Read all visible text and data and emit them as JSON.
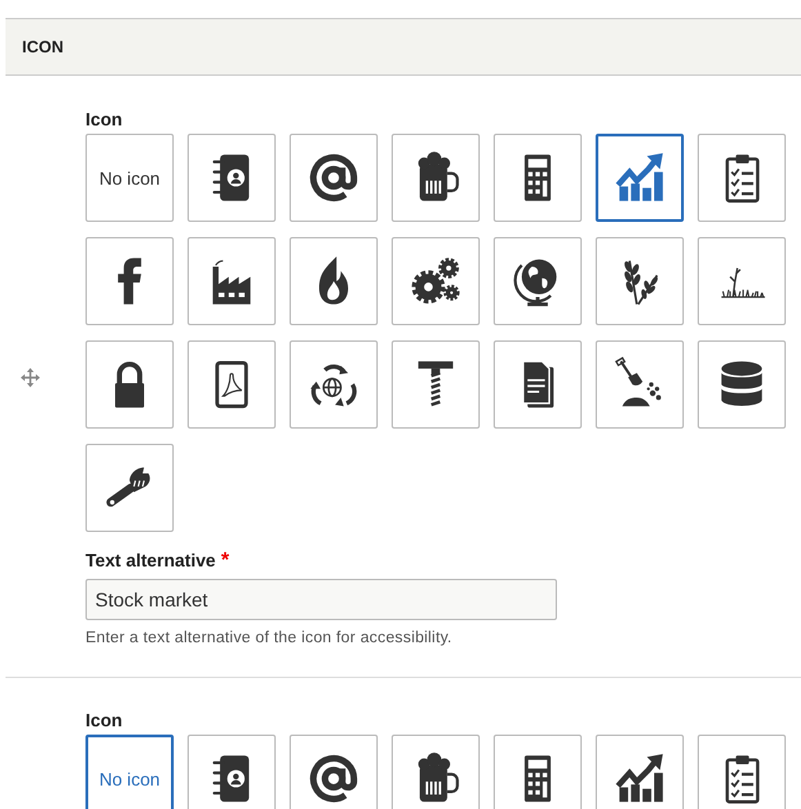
{
  "section": {
    "title": "ICON"
  },
  "widgets": [
    {
      "draggable": true,
      "label": "Icon",
      "tiles": [
        {
          "kind": "none",
          "label": "No icon",
          "selected": false
        },
        {
          "kind": "icon",
          "selected": false
        },
        {
          "kind": "icon",
          "selected": false
        },
        {
          "kind": "icon",
          "selected": false
        },
        {
          "kind": "icon",
          "selected": false
        },
        {
          "kind": "icon",
          "selected": true
        },
        {
          "kind": "icon",
          "selected": false
        },
        {
          "kind": "icon",
          "selected": false
        },
        {
          "kind": "icon",
          "selected": false
        },
        {
          "kind": "icon",
          "selected": false
        },
        {
          "kind": "icon",
          "selected": false
        },
        {
          "kind": "icon",
          "selected": false
        },
        {
          "kind": "icon",
          "selected": false
        },
        {
          "kind": "icon",
          "selected": false
        },
        {
          "kind": "icon",
          "selected": false
        },
        {
          "kind": "icon",
          "selected": false
        },
        {
          "kind": "icon",
          "selected": false
        },
        {
          "kind": "icon",
          "selected": false
        },
        {
          "kind": "icon",
          "selected": false
        },
        {
          "kind": "icon",
          "selected": false
        },
        {
          "kind": "icon",
          "selected": false
        },
        {
          "kind": "icon",
          "selected": false
        }
      ],
      "text_alternative": {
        "label": "Text alternative",
        "required_mark": "*",
        "value": "Stock market",
        "help": "Enter a text alternative of the icon for accessibility."
      }
    },
    {
      "label": "Icon",
      "tiles": [
        {
          "kind": "none",
          "label": "No icon",
          "selected": true
        },
        {
          "kind": "icon",
          "selected": false
        },
        {
          "kind": "icon",
          "selected": false
        },
        {
          "kind": "icon",
          "selected": false
        },
        {
          "kind": "icon",
          "selected": false
        },
        {
          "kind": "icon",
          "selected": false
        },
        {
          "kind": "icon",
          "selected": false
        }
      ]
    }
  ]
}
